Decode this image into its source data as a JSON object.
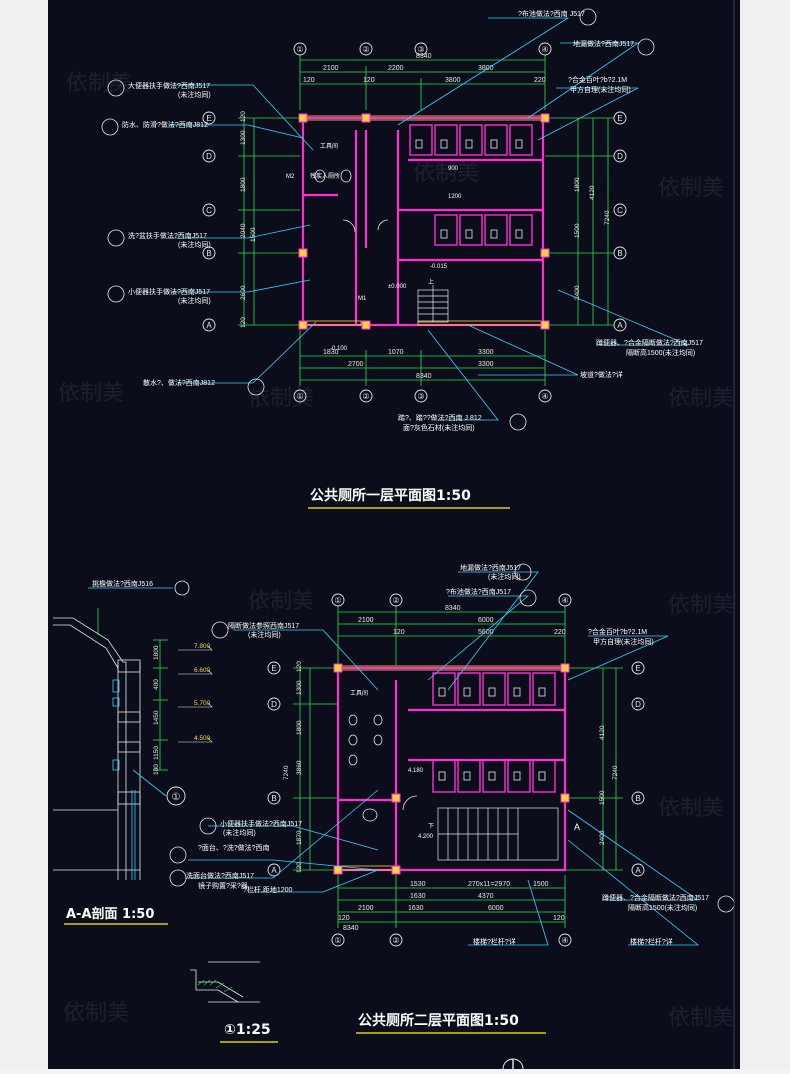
{
  "plan1": {
    "title": "公共厕所一层平面图1:50",
    "grid_cols": [
      "①",
      "②",
      "③",
      "④"
    ],
    "grid_rows": [
      "A",
      "B",
      "C",
      "D",
      "E"
    ],
    "dims_top_total": "8340",
    "dims_top": [
      "2100",
      "2200",
      "3800"
    ],
    "dims_top_sub": [
      "120",
      "120",
      "3800",
      "220"
    ],
    "dims_bottom": [
      "1830",
      "1070",
      "3300"
    ],
    "dims_bottom2": [
      "2700",
      "3300"
    ],
    "dims_bottom_total": "8340",
    "dims_left": [
      "120",
      "1300",
      "1800",
      "2040",
      "1500",
      "2600",
      "120"
    ],
    "dims_right": [
      "1800",
      "4120",
      "1500",
      "2400",
      "7240"
    ],
    "labels": {
      "note_handrail_stool": "大便器扶手做法?西南J517",
      "note_handrail_stool2": "(未注均同)",
      "note_waterproof": "防水、防滑?做法?西南J812",
      "note_basin": "洗?盆扶手做法?西南J517",
      "note_basin2": "(未注均同)",
      "note_urinal": "小便器扶手做法?西南J517",
      "note_urinal2": "(未注均同)",
      "note_drain": "散水?、做法?西南J812",
      "note_top": "?布池做法?西南 J517",
      "note_floor": "地漏做法?西南J517",
      "note_window": "?合金百叶?b?2.1M",
      "note_window2": "甲方自理(未注均同)",
      "note_partition": "蹲便器、?合金隔断做法?西南J517",
      "note_partition2": "隔断高1500(未注均同)",
      "note_ramp": "坡道?做法?详",
      "note_step": "踏?、踏??做法?西南 J 812",
      "note_step2": "面?灰色石材(未注均同)",
      "room_tool": "工具间",
      "room_access": "残疾人厕所",
      "elev_0": "±0.000",
      "elev_neg": "-0.100",
      "elev_015": "-0.015",
      "up": "上",
      "door_m1": "M1",
      "door_m2": "M2",
      "dim_900": "900",
      "dim_1200": "1200"
    }
  },
  "plan2": {
    "title": "公共厕所二层平面图1:50",
    "grid_cols": [
      "①",
      "②",
      "③",
      "④"
    ],
    "grid_rows": [
      "A",
      "B",
      "C",
      "D",
      "E"
    ],
    "dims_top_total": "8340",
    "dims_top": [
      "2100",
      "6000"
    ],
    "dims_top_sub": [
      "120",
      "5600",
      "220"
    ],
    "dims_bottom": [
      "1530",
      "1630",
      "270x11=2970",
      "1500"
    ],
    "dims_bottom_mid": "4370",
    "dims_bottom2": [
      "2100",
      "1630",
      "6000"
    ],
    "dims_bottom2_ends": [
      "120",
      "120"
    ],
    "dims_bottom_total": "8340",
    "dims_left": [
      "120",
      "1300",
      "1800",
      "3860",
      "1870",
      "120",
      "7240"
    ],
    "dims_right": [
      "4120",
      "1500",
      "2400",
      "7240"
    ],
    "labels": {
      "note_floor": "地漏做法?西南J517",
      "note_floor2": "(未注均同)",
      "note_pool": "?布池做法?西南J517",
      "note_door": "隔断做法参照西南J517",
      "note_door2": "(未注均同)",
      "note_window": "?合金百叶?b?2.1M",
      "note_window2": "甲方自理(未注均同)",
      "note_urinal": "小便器扶手做法?西南J517",
      "note_urinal2": "(未注均同)",
      "note_mirror": "洗面台做法?西南J517",
      "note_mirror2": "镜子购置?采?器",
      "note_sink": "?面台、?洗?做法?西南",
      "note_height": "?栏杆,距地1200",
      "note_partition": "蹲便器、?合金隔断做法?西南J517",
      "note_partition2": "隔断高1500(未注均同)",
      "note_rail": "楼梯?栏杆?详",
      "note_rail2": "楼梯?栏杆?详",
      "room_tool": "工具间",
      "elev_4200": "4.200",
      "elev_4180": "4.180",
      "down": "下",
      "section_mark": "A"
    }
  },
  "section": {
    "title": "A-A剖面  1:50",
    "note_roof": "挑檐做法?西南J516",
    "elevs": [
      "7.800",
      "6.600",
      "5.700",
      "4.500"
    ],
    "dims": [
      "1800",
      "400",
      "1450",
      "1150",
      "100"
    ],
    "detail_ref": "①"
  },
  "detail": {
    "title": "①1:25"
  },
  "watermark": "依制美",
  "colors": {
    "bg": "#0b0e1a",
    "wall": "#ff2dd2",
    "axis": "#e8e8e8",
    "dim": "#2bdc4b",
    "leader": "#35d0ff",
    "note": "#ffffff",
    "hatch": "#ffd23a",
    "title_underline": "#d9d400"
  }
}
